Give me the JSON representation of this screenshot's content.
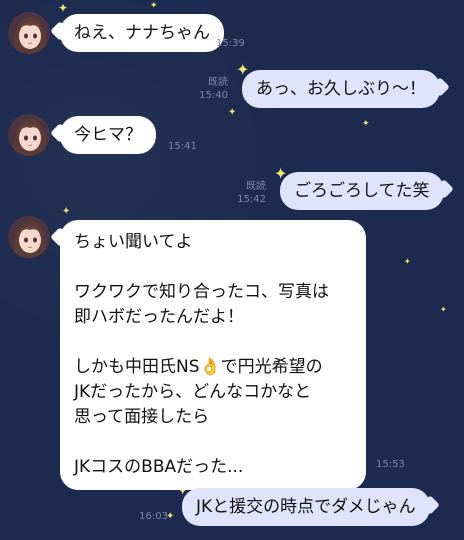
{
  "messages": [
    {
      "side": "left",
      "text": "ねえ、ナナちゃん",
      "time": "15:39"
    },
    {
      "side": "right",
      "text": "あっ、お久しぶり〜！",
      "read": "既読",
      "time": "15:40"
    },
    {
      "side": "left",
      "text": "今ヒマ？",
      "time": "15:41"
    },
    {
      "side": "right",
      "text": "ごろごろしてた笑",
      "read": "既読",
      "time": "15:42"
    },
    {
      "side": "left",
      "lines": [
        "ちょい聞いてよ",
        "",
        "ワクワクで知り合ったコ、写真は",
        "即ハボだったんだよ！",
        "",
        "しかも中田氏NS👌で円光希望の",
        "JKだったから、どんなコかなと",
        "思って面接したら",
        "",
        "JKコスのBBAだった..."
      ],
      "time": "15:53"
    },
    {
      "side": "right",
      "text": "JKと援交の時点でダメじゃん",
      "time": "16:03"
    }
  ],
  "colors": {
    "background": "#1c2a4f",
    "incoming_bubble": "#ffffff",
    "outgoing_bubble": "#dfe3fb",
    "star": "#f2e56a",
    "meta_text": "#7f8aa8"
  },
  "icons": {
    "avatar": "anime-girl-avatar-icon",
    "decoration": "star-icon"
  }
}
